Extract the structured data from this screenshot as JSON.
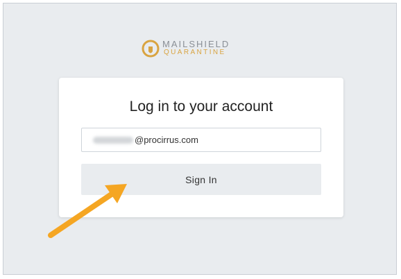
{
  "logo": {
    "line1": "MAILSHIELD",
    "line2": "QUARANTINE",
    "mark_color": "#d9a441",
    "text_color": "#8a8f96"
  },
  "login": {
    "title": "Log in to your account",
    "email_value_visible": "@procirrus.com",
    "sign_in_label": "Sign In"
  },
  "annotation": {
    "arrow_color": "#f5a623",
    "icon": "arrow-pointer-icon"
  }
}
